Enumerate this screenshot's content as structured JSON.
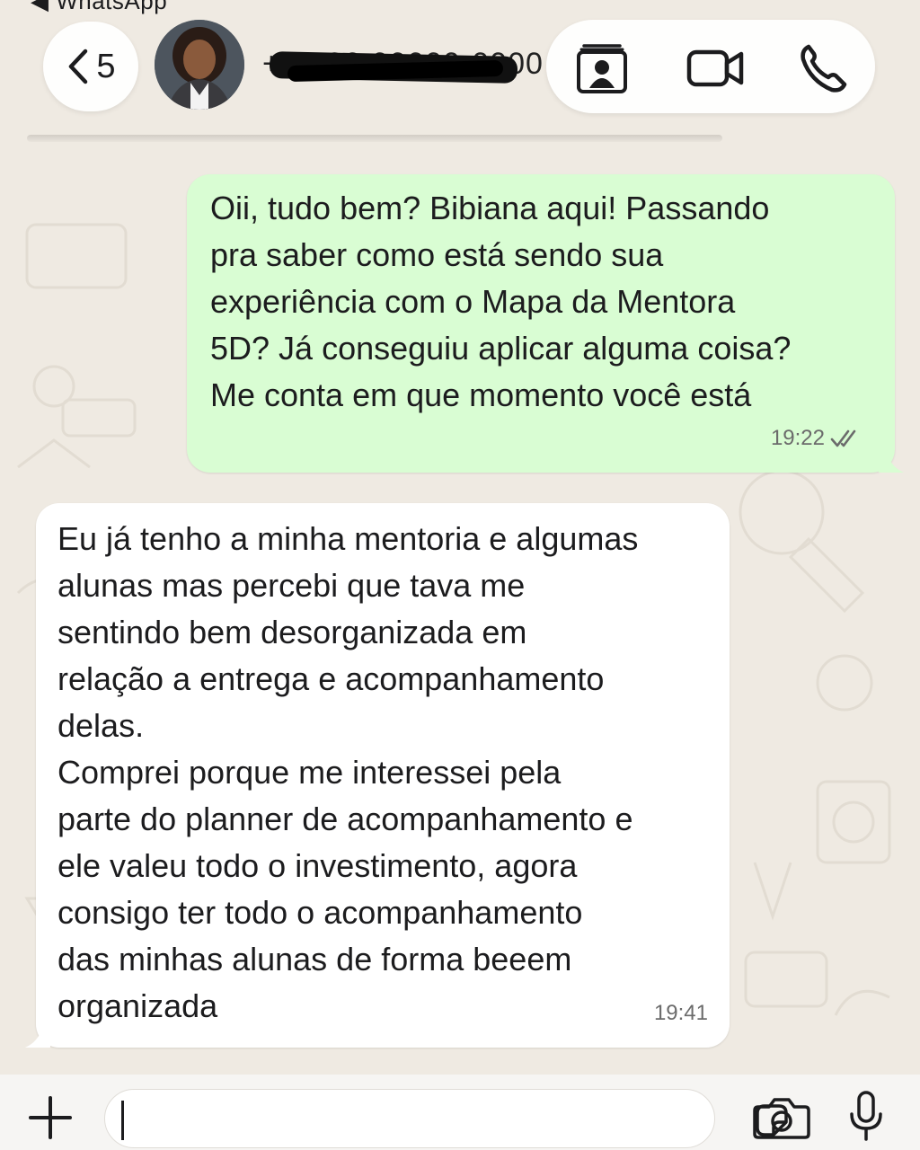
{
  "status_bar": {
    "back_app_label": "◀ WhatsApp"
  },
  "header": {
    "back_count": "5",
    "contact_name": "+55 00 00000-0000",
    "contact_name_redacted": true,
    "icons": [
      "chevron-left-icon",
      "contact-card-icon",
      "video-call-icon",
      "phone-call-icon"
    ]
  },
  "messages": [
    {
      "direction": "outgoing",
      "text": "Oii, tudo bem? Bibiana aqui! Passando\npra saber como está sendo sua\nexperiência com o Mapa da Mentora\n5D? Já conseguiu aplicar alguma coisa?\nMe conta em que momento você está",
      "time": "19:22",
      "status": "read",
      "status_icon": "double-check-icon",
      "bubble_color": "#d9fdd3"
    },
    {
      "direction": "incoming",
      "text": "Eu já tenho a minha mentoria e algumas\nalunas mas percebi que tava me\nsentindo bem desorganizada em\nrelação a entrega e acompanhamento\ndelas.\nComprei porque me interessei pela\nparte do planner de acompanhamento e\nele valeu todo o investimento, agora\nconsigo ter todo o acompanhamento\ndas minhas alunas de forma beeem\norganizada",
      "time": "19:41",
      "bubble_color": "#ffffff"
    }
  ],
  "composer": {
    "value": "",
    "icons": [
      "plus-icon",
      "sticker-icon",
      "camera-icon",
      "microphone-icon"
    ]
  },
  "colors": {
    "background": "#efeae2",
    "outgoing_bubble": "#d9fdd3",
    "incoming_bubble": "#ffffff",
    "meta_text": "#6b6b6b"
  }
}
